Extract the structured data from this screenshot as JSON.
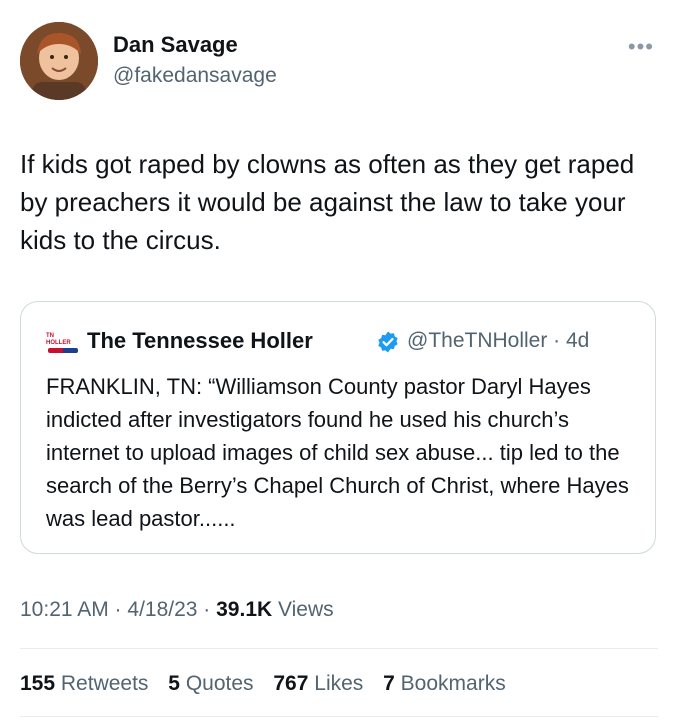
{
  "author": {
    "display_name": "Dan Savage",
    "handle": "@fakedansavage"
  },
  "more_icon": "ellipsis-icon",
  "tweet": {
    "text": "If kids got raped by clowns as often as they get raped by preachers it would be against the law to take your kids to the circus."
  },
  "quote": {
    "logo_text": "TN HOLLER",
    "name": "The Tennessee Holler",
    "verified_icon": "verified-badge-icon",
    "handle_time": "@TheTNHoller · 4d",
    "text": "FRANKLIN, TN: “Williamson County pastor Daryl Hayes indicted after investigators found he used his church’s internet to upload images of child sex abuse... tip led to the search of the Berry’s Chapel Church of Christ, where Hayes was lead pastor......"
  },
  "meta": {
    "time_date": "10:21 AM · 4/18/23 · ",
    "views_count": "39.1K",
    "views_label": " Views"
  },
  "stats": {
    "retweets_count": "155",
    "retweets_label": "Retweets",
    "quotes_count": "5",
    "quotes_label": "Quotes",
    "likes_count": "767",
    "likes_label": "Likes",
    "bookmarks_count": "7",
    "bookmarks_label": "Bookmarks"
  },
  "colors": {
    "text": "#0f1419",
    "secondary": "#536471",
    "verified": "#1d9bf0",
    "border": "#cfd9de"
  }
}
